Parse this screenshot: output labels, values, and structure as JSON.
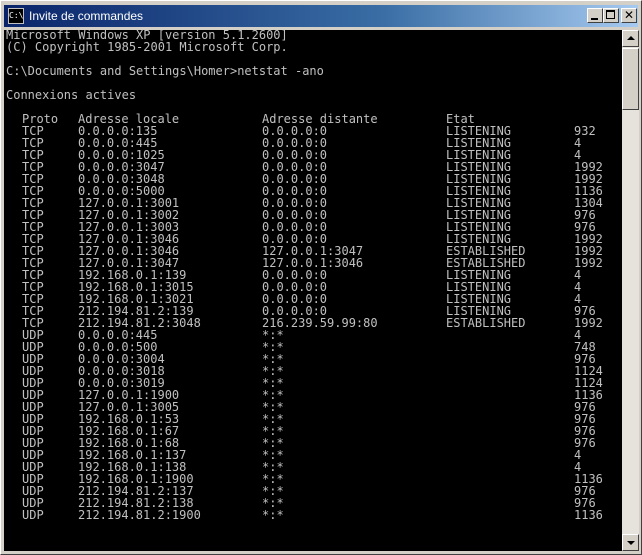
{
  "window": {
    "title": "Invite de commandes",
    "icon_name": "cmd-icon",
    "icon_label": "C:\\"
  },
  "console": {
    "header_lines": [
      "Microsoft Windows XP [version 5.1.2600]",
      "(C) Copyright 1985-2001 Microsoft Corp.",
      "",
      "C:\\Documents and Settings\\Homer>netstat -ano",
      "",
      "Connexions actives",
      ""
    ],
    "columns": {
      "proto": "Proto",
      "local": "Adresse locale",
      "remote": "Adresse distante",
      "state": "Etat",
      "pid": ""
    },
    "rows": [
      [
        "TCP",
        "0.0.0.0:135",
        "0.0.0.0:0",
        "LISTENING",
        "932"
      ],
      [
        "TCP",
        "0.0.0.0:445",
        "0.0.0.0:0",
        "LISTENING",
        "4"
      ],
      [
        "TCP",
        "0.0.0.0:1025",
        "0.0.0.0:0",
        "LISTENING",
        "4"
      ],
      [
        "TCP",
        "0.0.0.0:3047",
        "0.0.0.0:0",
        "LISTENING",
        "1992"
      ],
      [
        "TCP",
        "0.0.0.0:3048",
        "0.0.0.0:0",
        "LISTENING",
        "1992"
      ],
      [
        "TCP",
        "0.0.0.0:5000",
        "0.0.0.0:0",
        "LISTENING",
        "1136"
      ],
      [
        "TCP",
        "127.0.0.1:3001",
        "0.0.0.0:0",
        "LISTENING",
        "1304"
      ],
      [
        "TCP",
        "127.0.0.1:3002",
        "0.0.0.0:0",
        "LISTENING",
        "976"
      ],
      [
        "TCP",
        "127.0.0.1:3003",
        "0.0.0.0:0",
        "LISTENING",
        "976"
      ],
      [
        "TCP",
        "127.0.0.1:3046",
        "0.0.0.0:0",
        "LISTENING",
        "1992"
      ],
      [
        "TCP",
        "127.0.0.1:3046",
        "127.0.0.1:3047",
        "ESTABLISHED",
        "1992"
      ],
      [
        "TCP",
        "127.0.0.1:3047",
        "127.0.0.1:3046",
        "ESTABLISHED",
        "1992"
      ],
      [
        "TCP",
        "192.168.0.1:139",
        "0.0.0.0:0",
        "LISTENING",
        "4"
      ],
      [
        "TCP",
        "192.168.0.1:3015",
        "0.0.0.0:0",
        "LISTENING",
        "4"
      ],
      [
        "TCP",
        "192.168.0.1:3021",
        "0.0.0.0:0",
        "LISTENING",
        "4"
      ],
      [
        "TCP",
        "212.194.81.2:139",
        "0.0.0.0:0",
        "LISTENING",
        "976"
      ],
      [
        "TCP",
        "212.194.81.2:3048",
        "216.239.59.99:80",
        "ESTABLISHED",
        "1992"
      ],
      [
        "UDP",
        "0.0.0.0:445",
        "*:*",
        "",
        "4"
      ],
      [
        "UDP",
        "0.0.0.0:500",
        "*:*",
        "",
        "748"
      ],
      [
        "UDP",
        "0.0.0.0:3004",
        "*:*",
        "",
        "976"
      ],
      [
        "UDP",
        "0.0.0.0:3018",
        "*:*",
        "",
        "1124"
      ],
      [
        "UDP",
        "0.0.0.0:3019",
        "*:*",
        "",
        "1124"
      ],
      [
        "UDP",
        "127.0.0.1:1900",
        "*:*",
        "",
        "1136"
      ],
      [
        "UDP",
        "127.0.0.1:3005",
        "*:*",
        "",
        "976"
      ],
      [
        "UDP",
        "192.168.0.1:53",
        "*:*",
        "",
        "976"
      ],
      [
        "UDP",
        "192.168.0.1:67",
        "*:*",
        "",
        "976"
      ],
      [
        "UDP",
        "192.168.0.1:68",
        "*:*",
        "",
        "976"
      ],
      [
        "UDP",
        "192.168.0.1:137",
        "*:*",
        "",
        "4"
      ],
      [
        "UDP",
        "192.168.0.1:138",
        "*:*",
        "",
        "4"
      ],
      [
        "UDP",
        "192.168.0.1:1900",
        "*:*",
        "",
        "1136"
      ],
      [
        "UDP",
        "212.194.81.2:137",
        "*:*",
        "",
        "976"
      ],
      [
        "UDP",
        "212.194.81.2:138",
        "*:*",
        "",
        "976"
      ],
      [
        "UDP",
        "212.194.81.2:1900",
        "*:*",
        "",
        "1136"
      ]
    ],
    "text_color": "#c0c0c0",
    "background_color": "#000000"
  },
  "colors": {
    "titlebar_start": "#0a246a",
    "titlebar_end": "#a6caf0",
    "chrome": "#d4d0c8"
  },
  "controls": {
    "minimize_icon": "minimize-icon",
    "maximize_icon": "maximize-icon",
    "close_icon": "close-icon",
    "close_glyph": "✕"
  }
}
